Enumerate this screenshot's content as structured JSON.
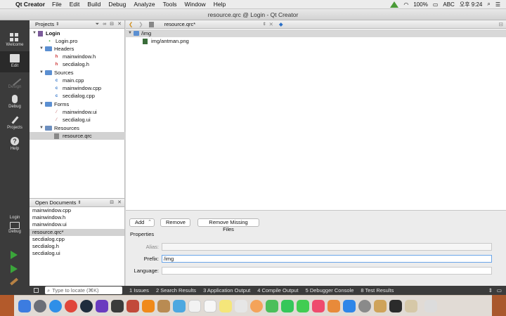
{
  "menubar": {
    "app": "Qt Creator",
    "menus": [
      "File",
      "Edit",
      "Build",
      "Debug",
      "Analyze",
      "Tools",
      "Window",
      "Help"
    ],
    "battery": "100%",
    "input": "ABC",
    "clock": "오후 9:24"
  },
  "window": {
    "title": "resource.qrc @ Login - Qt Creator"
  },
  "modes": {
    "welcome": "Welcome",
    "edit": "Edit",
    "design": "Design",
    "debug": "Debug",
    "projects": "Projects",
    "help": "Help",
    "kit_project": "Login",
    "kit_mode": "Debug"
  },
  "projects": {
    "header": "Projects",
    "tree": {
      "root": "Login",
      "pro": "Login.pro",
      "headers": "Headers",
      "headers_items": [
        "mainwindow.h",
        "secdialog.h"
      ],
      "sources": "Sources",
      "sources_items": [
        "main.cpp",
        "mainwindow.cpp",
        "secdialog.cpp"
      ],
      "forms": "Forms",
      "forms_items": [
        "mainwindow.ui",
        "secdialog.ui"
      ],
      "resources": "Resources",
      "resources_items": [
        "resource.qrc"
      ]
    }
  },
  "open_documents": {
    "header": "Open Documents",
    "items": [
      "mainwindow.cpp",
      "mainwindow.h",
      "mainwindow.ui",
      "resource.qrc*",
      "secdialog.cpp",
      "secdialog.h",
      "secdialog.ui"
    ]
  },
  "editor": {
    "document": "resource.qrc*",
    "resources": {
      "prefix_node": "/img",
      "file_node": "img/antman.png"
    },
    "buttons": {
      "add": "Add",
      "remove": "Remove",
      "remove_missing": "Remove Missing Files"
    },
    "properties": {
      "title": "Properties",
      "alias_label": "Alias:",
      "alias_value": "",
      "prefix_label": "Prefix:",
      "prefix_value": "/img",
      "language_label": "Language:",
      "language_value": ""
    }
  },
  "bottombar": {
    "locator_placeholder": "Type to locate (⌘K)",
    "panes": [
      "1  Issues",
      "2  Search Results",
      "3  Application Output",
      "4  Compile Output",
      "5  Debugger Console",
      "8  Test Results"
    ]
  }
}
